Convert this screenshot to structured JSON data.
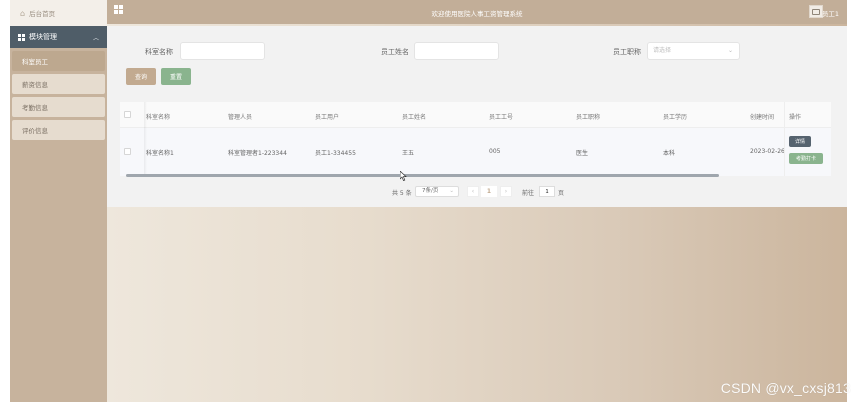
{
  "app": {
    "title": "欢迎使用医院人事工资管理系统",
    "home_link": "后台首页",
    "user_name": "员工1"
  },
  "sidebar": {
    "section_label": "模块管理",
    "items": [
      {
        "label": "科室员工",
        "active": true
      },
      {
        "label": "薪资信息",
        "active": false
      },
      {
        "label": "考勤信息",
        "active": false
      },
      {
        "label": "评价信息",
        "active": false
      }
    ]
  },
  "search": {
    "dept_label": "科室名称",
    "dept_value": "",
    "name_label": "员工姓名",
    "name_value": "",
    "title_label": "员工职称",
    "title_placeholder": "请选择",
    "query_button": "查询",
    "reset_button": "重置"
  },
  "table": {
    "columns": [
      "科室名称",
      "管理人员",
      "员工用户",
      "员工姓名",
      "员工工号",
      "员工职称",
      "员工学历",
      "创建时间"
    ],
    "operation_header": "操作",
    "rows": [
      {
        "cells": [
          "科室名称1",
          "科室管理者1-223344",
          "员工1-334455",
          "王五",
          "005",
          "医生",
          "本科",
          "2023-02-26"
        ],
        "detail_button": "详情",
        "attendance_button": "考勤打卡"
      }
    ]
  },
  "pagination": {
    "total_text": "共 5 条",
    "page_size": "7条/页",
    "current_page": "1",
    "goto_label": "前往",
    "goto_value": "1",
    "page_suffix": "页"
  },
  "watermark": "CSDN @vx_cxsj813",
  "colors": {
    "sidebar": "#c7b39d",
    "menu_header": "#4f5d68",
    "topbar": "#c2ae98",
    "active_item": "#bda88f",
    "reset_button": "#8ab48e"
  }
}
